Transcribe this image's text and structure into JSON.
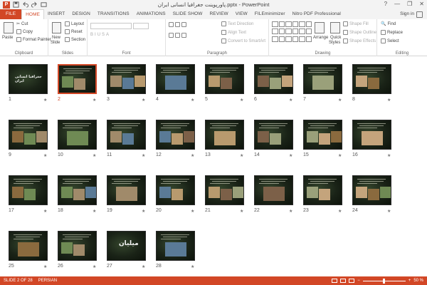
{
  "window": {
    "title": "پاورپوینت جغرافیا انسانی ایران.pptx - PowerPoint",
    "controls": [
      "?",
      "—",
      "❐",
      "✕"
    ]
  },
  "tabs": [
    {
      "label": "FILE",
      "type": "file"
    },
    {
      "label": "HOME",
      "type": "active"
    },
    {
      "label": "INSERT"
    },
    {
      "label": "DESIGN"
    },
    {
      "label": "TRANSITIONS"
    },
    {
      "label": "ANIMATIONS"
    },
    {
      "label": "SLIDE SHOW"
    },
    {
      "label": "REVIEW"
    },
    {
      "label": "VIEW"
    },
    {
      "label": "FILEminimizer"
    },
    {
      "label": "Nitro PDF Professional"
    }
  ],
  "signin": "Sign in",
  "ribbon": {
    "clipboard": {
      "label": "Clipboard",
      "paste": "Paste",
      "cut": "Cut",
      "copy": "Copy",
      "format_painter": "Format Painter"
    },
    "slides": {
      "label": "Slides",
      "new_slide": "New",
      "new_slide2": "Slide",
      "layout": "Layout",
      "reset": "Reset",
      "section": "Section"
    },
    "font": {
      "label": "Font"
    },
    "paragraph": {
      "label": "Paragraph",
      "text_direction": "Text Direction",
      "align_text": "Align Text",
      "convert": "Convert to SmartArt"
    },
    "drawing": {
      "label": "Drawing",
      "arrange": "Arrange",
      "quick_styles": "Quick",
      "quick_styles2": "Styles",
      "shape_fill": "Shape Fill",
      "shape_outline": "Shape Outline",
      "shape_effects": "Shape Effects"
    },
    "editing": {
      "label": "Editing",
      "find": "Find",
      "replace": "Replace",
      "select": "Select"
    }
  },
  "slides": [
    {
      "n": "1",
      "big": "جغرافیا انسانی ایران"
    },
    {
      "n": "2",
      "selected": true
    },
    {
      "n": "3"
    },
    {
      "n": "4"
    },
    {
      "n": "5"
    },
    {
      "n": "6"
    },
    {
      "n": "7"
    },
    {
      "n": "8"
    },
    {
      "n": "9"
    },
    {
      "n": "10"
    },
    {
      "n": "11"
    },
    {
      "n": "12"
    },
    {
      "n": "13"
    },
    {
      "n": "14"
    },
    {
      "n": "15"
    },
    {
      "n": "16"
    },
    {
      "n": "17"
    },
    {
      "n": "18"
    },
    {
      "n": "19"
    },
    {
      "n": "20"
    },
    {
      "n": "21"
    },
    {
      "n": "22"
    },
    {
      "n": "23"
    },
    {
      "n": "24"
    },
    {
      "n": "25"
    },
    {
      "n": "26"
    },
    {
      "n": "27",
      "big": "میلیان"
    },
    {
      "n": "28"
    }
  ],
  "star_glyph": "★",
  "status": {
    "slide": "SLIDE 2 OF 28",
    "language": "PERSIAN",
    "zoom": "50 %",
    "zoom_level_percent": 50
  },
  "colors": {
    "accent": "#d24726",
    "slide_bg": "#1c2618"
  }
}
